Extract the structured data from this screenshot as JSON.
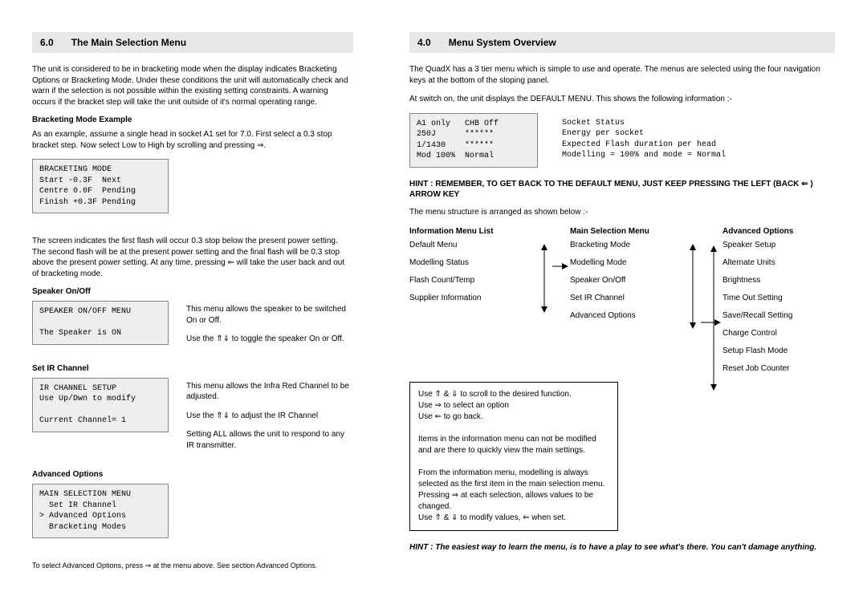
{
  "left": {
    "sec_num": "6.0",
    "sec_title": "The Main Selection Menu",
    "intro": "The unit is considered to be in bracketing mode when the display indicates Bracketing Options or Bracketing Mode.  Under these conditions the unit will automatically check and warn if the selection is not possible within the existing setting constraints.  A warning occurs if the bracket step will take the unit outside of it's normal operating range.",
    "bme_head": "Bracketing  Mode Example",
    "bme_text": "As an example, assume a single head in socket A1 set for 7.0.  First select a 0.3 stop bracket step.  Now select Low to High by scrolling and pressing ⇒.",
    "bme_box": "BRACKETING MODE\nStart -0.3F  Next\nCentre 0.0F  Pending\nFinish +0.3F Pending",
    "after_bme": "The screen indicates the first flash will occur 0.3 stop below the present power setting.  The second flash will be at the present power setting and the final flash will be 0.3 stop above the present power setting.  At any time, pressing ⇐ will take the user back and out of bracketing mode.",
    "spk_head": "Speaker On/Off",
    "spk_box": "SPEAKER ON/OFF MENU\n\nThe Speaker is ON",
    "spk_desc1": "This menu allows the speaker to be switched On or Off.",
    "spk_desc2": "Use the ⇑⇓ to toggle the speaker On or Off.",
    "ir_head": "Set IR Channel",
    "ir_box": "IR CHANNEL SETUP\nUse Up/Dwn to modify\n\nCurrent Channel= 1",
    "ir_desc1": "This menu allows the Infra Red Channel to be adjusted.",
    "ir_desc2": "Use the ⇑⇓ to adjust the IR Channel",
    "ir_desc3": "Setting ALL allows the unit to respond to any IR transmitter.",
    "adv_head": "Advanced Options",
    "adv_box": "MAIN SELECTION MENU\n  Set IR Channel\n> Advanced Options\n  Bracketing Modes",
    "adv_foot": "To select Advanced Options, press  ⇒ at the menu above.  See section Advanced Options."
  },
  "right": {
    "sec_num": "4.0",
    "sec_title": "Menu System Overview",
    "intro": "The QuadX has a 3 tier menu which is  simple to use and operate.  The menus are selected using the four navigation keys at the bottom of the sloping panel.",
    "intro2": "At switch on, the unit displays the DEFAULT MENU.  This shows the following information :-",
    "def_box": "A1 only   CHB Off\n250J      ******\n1/1430    ******\nMod 100%  Normal",
    "def_legend": "Socket Status\nEnergy per socket\nExpected Flash duration per head\nModelling = 100% and mode = Normal",
    "hint_bold": "HINT : REMEMBER, TO GET BACK TO THE DEFAULT MENU, JUST KEEP PRESSING THE LEFT (BACK ⇐ ) ARROW  KEY",
    "arranged": "The menu structure is arranged as shown below :-",
    "h1": "Information Menu List",
    "h2": "Main Selection Menu",
    "h3": "Advanced Options",
    "col1": [
      "Default Menu",
      "Modelling Status",
      "Flash Count/Temp",
      "Supplier Information"
    ],
    "col2": [
      "Bracketing Mode",
      "Modelling Mode",
      "Speaker On/Off",
      "Set IR Channel",
      "Advanced Options"
    ],
    "col3": [
      "Speaker Setup",
      "Alternate Units",
      "Brightness",
      "Time Out Setting",
      "Save/Recall Setting",
      "Charge Control",
      "Setup Flash Mode",
      "Reset Job Counter"
    ],
    "help": "Use ⇑ & ⇓ to scroll to the desired function.\nUse ⇒ to select an option\nUse ⇐ to go back.\n\nItems in the information menu can not be modified and are there to quickly view the main settings.\n\nFrom the information menu, modelling is always selected as the first item in the main selection menu.\nPressing ⇒ at each selection, allows values to be changed.\nUse ⇑ & ⇓ to modify values, ⇐ when set.",
    "hint_italic": "HINT : The easiest way to learn the menu, is to have a play to see what's there. You can't damage anything."
  }
}
